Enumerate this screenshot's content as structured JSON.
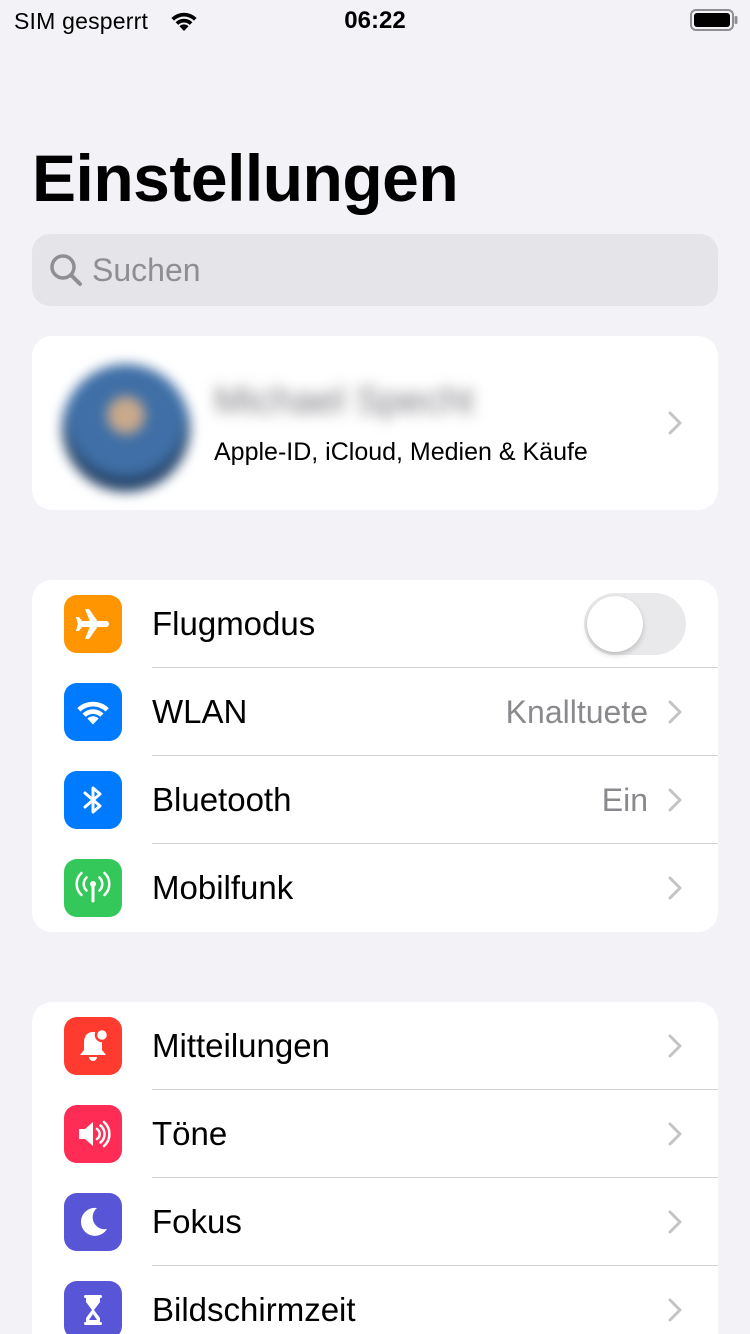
{
  "status_bar": {
    "carrier": "SIM gesperrt",
    "time": "06:22",
    "icons": [
      "wifi-icon",
      "battery-icon"
    ]
  },
  "title": "Einstellungen",
  "search": {
    "placeholder": "Suchen",
    "value": ""
  },
  "profile": {
    "name": "Michael Specht",
    "subtitle": "Apple-ID, iCloud, Medien & Käufe"
  },
  "group1": [
    {
      "label": "Flugmodus",
      "icon": "airplane-icon",
      "color": "#ff9500",
      "toggle": false
    },
    {
      "label": "WLAN",
      "icon": "wifi-icon",
      "color": "#007aff",
      "value": "Knalltuete"
    },
    {
      "label": "Bluetooth",
      "icon": "bluetooth-icon",
      "color": "#007aff",
      "value": "Ein"
    },
    {
      "label": "Mobilfunk",
      "icon": "antenna-icon",
      "color": "#34c759"
    }
  ],
  "group2": [
    {
      "label": "Mitteilungen",
      "icon": "notification-icon",
      "color": "#ff3b30"
    },
    {
      "label": "Töne",
      "icon": "speaker-icon",
      "color": "#ff2d55"
    },
    {
      "label": "Fokus",
      "icon": "moon-icon",
      "color": "#5856d6"
    },
    {
      "label": "Bildschirmzeit",
      "icon": "hourglass-icon",
      "color": "#5856d6"
    }
  ],
  "colors": {
    "background": "#f2f2f7",
    "card": "#ffffff",
    "secondary_text": "#8a8a8e",
    "separator": "#d1d1d6"
  }
}
